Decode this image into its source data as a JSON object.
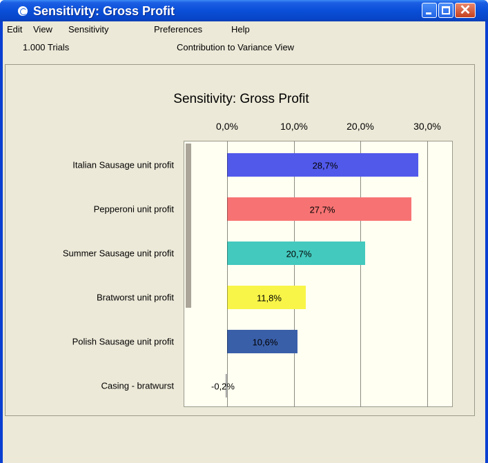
{
  "window": {
    "title": "Sensitivity: Gross Profit",
    "icons": {
      "app": "crystal-ball-icon",
      "minimize": "minimize-icon",
      "maximize": "maximize-icon",
      "close": "close-icon"
    }
  },
  "menu": {
    "items": [
      "Edit",
      "View",
      "Sensitivity",
      "Preferences",
      "Help"
    ]
  },
  "info": {
    "trials": "1.000 Trials",
    "view": "Contribution to Variance View"
  },
  "chart_data": {
    "type": "bar",
    "orientation": "horizontal",
    "title": "Sensitivity: Gross Profit",
    "xlim": [
      -5,
      34
    ],
    "ticks": [
      {
        "value": 0,
        "label": "0,0%"
      },
      {
        "value": 10,
        "label": "10,0%"
      },
      {
        "value": 20,
        "label": "20,0%"
      },
      {
        "value": 30,
        "label": "30,0%"
      }
    ],
    "grid": true,
    "categories": [
      "Italian Sausage unit profit",
      "Pepperoni unit profit",
      "Summer Sausage unit profit",
      "Bratworst unit profit",
      "Polish Sausage unit profit",
      "Casing - bratwurst"
    ],
    "values": [
      28.7,
      27.7,
      20.7,
      11.8,
      10.6,
      -0.2
    ],
    "labels": [
      "28,7%",
      "27,7%",
      "20,7%",
      "11,8%",
      "10,6%",
      "-0,2%"
    ],
    "colors": [
      "#5159ea",
      "#f77373",
      "#43c9be",
      "#f8f548",
      "#3a5fa9",
      "#cccccc"
    ]
  }
}
